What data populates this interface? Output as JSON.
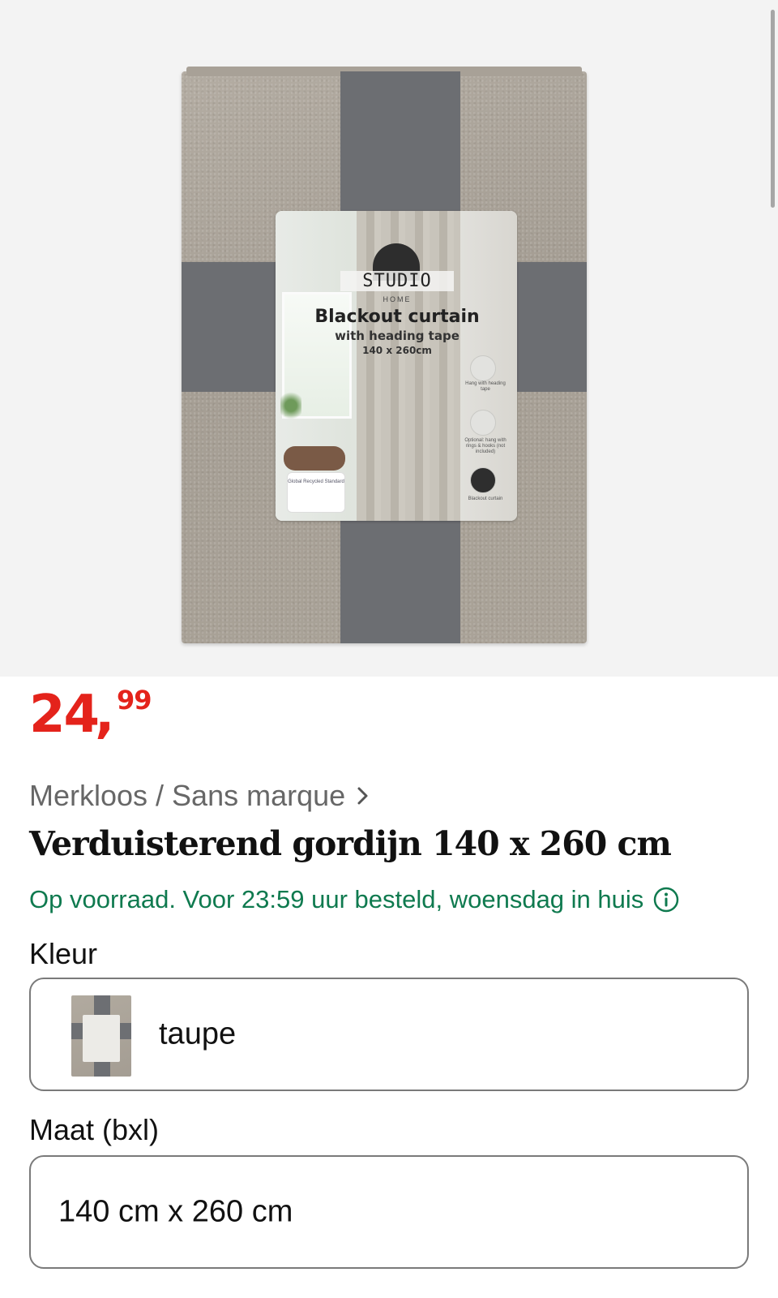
{
  "product_image": {
    "label_brand": "STUDIO",
    "label_brand_sub": "HOME",
    "label_title": "Blackout curtain",
    "label_subtitle": "with heading tape",
    "label_size": "140 x 260cm",
    "note_1": "Hang with heading tape",
    "note_2": "Optional: hang with rings & hooks (not included)",
    "note_3": "Blackout curtain",
    "badge": "Global Recycled Standard"
  },
  "price": {
    "integer": "24",
    "comma": ",",
    "decimals": "99",
    "color": "#e4231b"
  },
  "brand": {
    "label": "Merkloos / Sans marque",
    "icon": "chevron-right-icon"
  },
  "title": "Verduisterend gordijn 140 x 260 cm",
  "stock": {
    "text": "Op voorraad. Voor 23:59 uur besteld, woensdag in huis",
    "color": "#0f7a4f",
    "icon": "info-icon"
  },
  "options": {
    "color_label": "Kleur",
    "color_value": "taupe",
    "size_label": "Maat (bxl)",
    "size_value": "140 cm x 260 cm"
  }
}
